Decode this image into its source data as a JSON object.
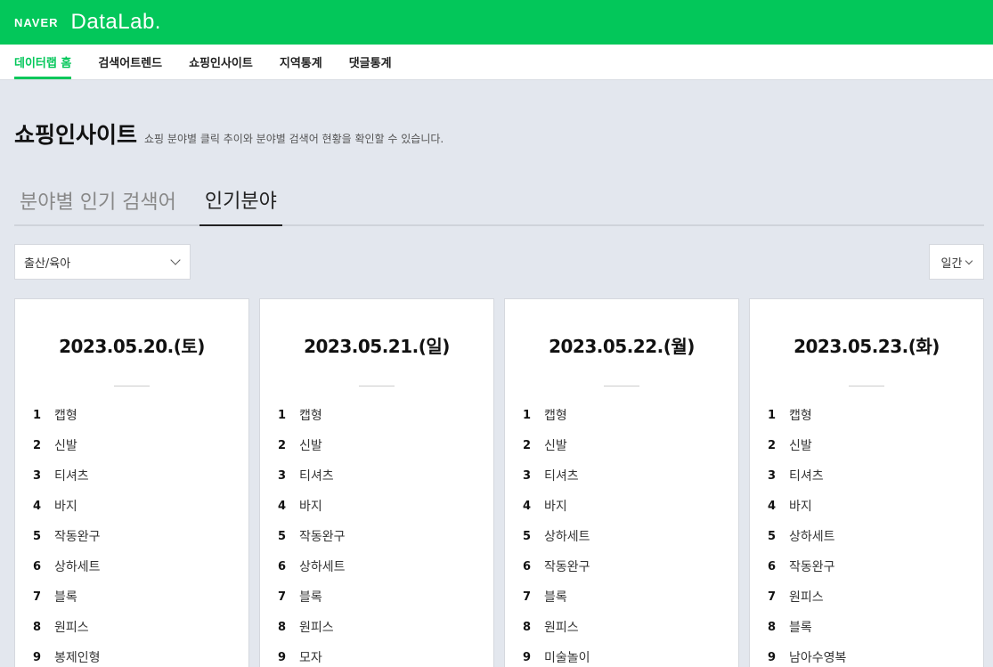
{
  "header": {
    "brand": "NAVER",
    "product": "DataLab."
  },
  "nav": {
    "items": [
      {
        "label": "데이터랩 홈",
        "active": true
      },
      {
        "label": "검색어트렌드",
        "active": false
      },
      {
        "label": "쇼핑인사이트",
        "active": false
      },
      {
        "label": "지역통계",
        "active": false
      },
      {
        "label": "댓글통계",
        "active": false
      }
    ]
  },
  "page": {
    "title": "쇼핑인사이트",
    "description": "쇼핑 분야별 클릭 추이와 분야별 검색어 현황을 확인할 수 있습니다."
  },
  "tabs": [
    {
      "label": "분야별 인기 검색어",
      "active": false
    },
    {
      "label": "인기분야",
      "active": true
    }
  ],
  "filters": {
    "category": "출산/육아",
    "period": "일간"
  },
  "cards": [
    {
      "date": "2023.05.20.(토)",
      "ranks": [
        {
          "num": "1",
          "name": "캡형"
        },
        {
          "num": "2",
          "name": "신발"
        },
        {
          "num": "3",
          "name": "티셔츠"
        },
        {
          "num": "4",
          "name": "바지"
        },
        {
          "num": "5",
          "name": "작동완구"
        },
        {
          "num": "6",
          "name": "상하세트"
        },
        {
          "num": "7",
          "name": "블록"
        },
        {
          "num": "8",
          "name": "원피스"
        },
        {
          "num": "9",
          "name": "봉제인형"
        }
      ]
    },
    {
      "date": "2023.05.21.(일)",
      "ranks": [
        {
          "num": "1",
          "name": "캡형"
        },
        {
          "num": "2",
          "name": "신발"
        },
        {
          "num": "3",
          "name": "티셔츠"
        },
        {
          "num": "4",
          "name": "바지"
        },
        {
          "num": "5",
          "name": "작동완구"
        },
        {
          "num": "6",
          "name": "상하세트"
        },
        {
          "num": "7",
          "name": "블록"
        },
        {
          "num": "8",
          "name": "원피스"
        },
        {
          "num": "9",
          "name": "모자"
        }
      ]
    },
    {
      "date": "2023.05.22.(월)",
      "ranks": [
        {
          "num": "1",
          "name": "캡형"
        },
        {
          "num": "2",
          "name": "신발"
        },
        {
          "num": "3",
          "name": "티셔츠"
        },
        {
          "num": "4",
          "name": "바지"
        },
        {
          "num": "5",
          "name": "상하세트"
        },
        {
          "num": "6",
          "name": "작동완구"
        },
        {
          "num": "7",
          "name": "블록"
        },
        {
          "num": "8",
          "name": "원피스"
        },
        {
          "num": "9",
          "name": "미술놀이"
        }
      ]
    },
    {
      "date": "2023.05.23.(화)",
      "ranks": [
        {
          "num": "1",
          "name": "캡형"
        },
        {
          "num": "2",
          "name": "신발"
        },
        {
          "num": "3",
          "name": "티셔츠"
        },
        {
          "num": "4",
          "name": "바지"
        },
        {
          "num": "5",
          "name": "상하세트"
        },
        {
          "num": "6",
          "name": "작동완구"
        },
        {
          "num": "7",
          "name": "원피스"
        },
        {
          "num": "8",
          "name": "블록"
        },
        {
          "num": "9",
          "name": "남아수영복"
        }
      ]
    }
  ]
}
